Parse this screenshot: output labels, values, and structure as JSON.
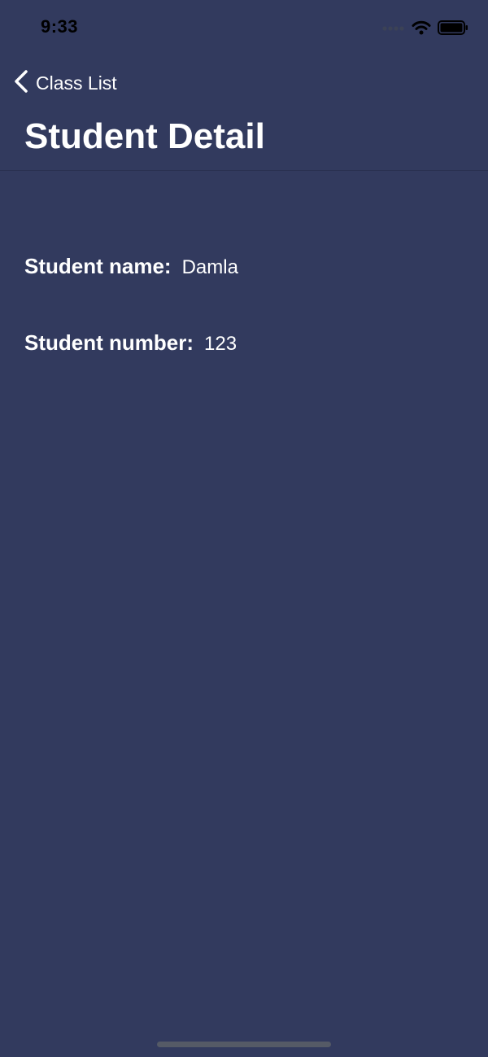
{
  "status_bar": {
    "time": "9:33",
    "icons": [
      "signal-icon",
      "wifi-icon",
      "battery-icon"
    ]
  },
  "nav": {
    "back_label": "Class List",
    "title": "Student Detail"
  },
  "student": {
    "name_label": "Student name:",
    "name_value": "Damla",
    "number_label": "Student number:",
    "number_value": "123"
  },
  "colors": {
    "background": "#323a5e",
    "text": "#ffffff",
    "status_text": "#000000"
  }
}
